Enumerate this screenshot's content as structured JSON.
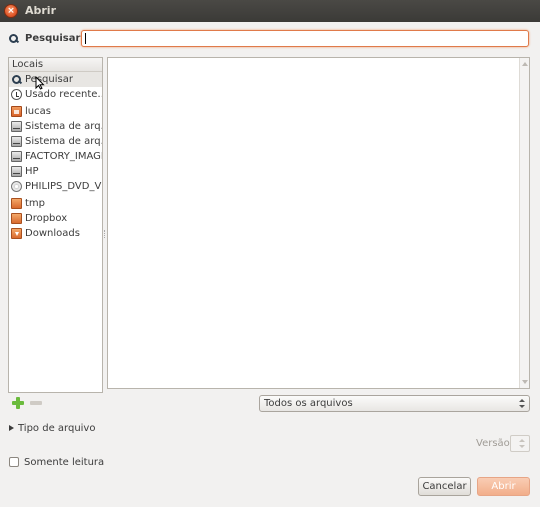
{
  "window": {
    "title": "Abrir",
    "close_glyph": "×"
  },
  "search": {
    "label": "Pesquisar:",
    "value": "",
    "icon": "search-icon"
  },
  "places": {
    "header": "Locais",
    "items": [
      {
        "label": "Pesquisar",
        "icon": "search-icon"
      },
      {
        "label": "Usado recente…",
        "icon": "recent-clock-icon"
      },
      {
        "label": "lucas",
        "icon": "home-folder-icon"
      },
      {
        "label": "Sistema de arq…",
        "icon": "drive-icon"
      },
      {
        "label": "Sistema de arq…",
        "icon": "drive-icon"
      },
      {
        "label": "FACTORY_IMAGE",
        "icon": "drive-icon"
      },
      {
        "label": "HP",
        "icon": "drive-icon"
      },
      {
        "label": "PHILIPS_DVD_VR",
        "icon": "disc-icon"
      },
      {
        "label": "tmp",
        "icon": "folder-icon"
      },
      {
        "label": "Dropbox",
        "icon": "folder-icon"
      },
      {
        "label": "Downloads",
        "icon": "download-folder-icon"
      }
    ]
  },
  "filter": {
    "selected": "Todos os arquivos"
  },
  "file_type_expander": {
    "label": "Tipo de arquivo",
    "expanded": false
  },
  "version": {
    "label": "Versão:"
  },
  "read_only": {
    "label": "Somente leitura",
    "checked": false
  },
  "buttons": {
    "cancel": "Cancelar",
    "open": "Abrir"
  },
  "colors": {
    "accent": "#e07a4a",
    "open_button": "#f2ae8a",
    "titlebar": "#3b3a37"
  }
}
